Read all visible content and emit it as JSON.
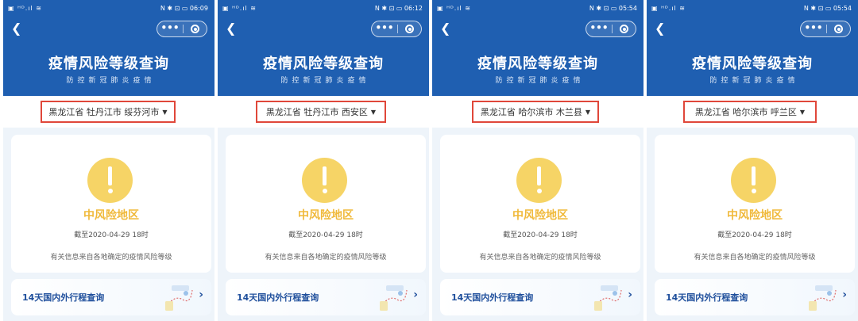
{
  "app": {
    "title": "疫情风险等级查询",
    "subtitle": "防控新冠肺炎疫情",
    "back_icon": "chevron-left-icon",
    "menu_icon": "more-dots-icon",
    "close_icon": "target-circle-icon",
    "header_color": "#1f5fb1",
    "highlight_color": "#e0473a",
    "risk_color": "#f6d466"
  },
  "screens": [
    {
      "status": {
        "left": "▣ ᴴᴰ.ıl ≋",
        "right": "N ✱ ⊡ ▭ 06:09"
      },
      "region": "黑龙江省 牡丹江市 绥芬河市",
      "risk_level": "中风险地区",
      "as_of": "截至2020-04-29 18时",
      "info_note": "有关信息来自各地确定的疫情风险等级",
      "trip_query": "14天国内外行程查询",
      "arrow": "›"
    },
    {
      "status": {
        "left": "▣ ᴴᴰ.ıl ≋",
        "right": "N ✱ ⊡ ▭ 06:12"
      },
      "region": "黑龙江省 牡丹江市 西安区",
      "risk_level": "中风险地区",
      "as_of": "截至2020-04-29 18时",
      "info_note": "有关信息来自各地确定的疫情风险等级",
      "trip_query": "14天国内外行程查询",
      "arrow": "›"
    },
    {
      "status": {
        "left": "▣ ᴴᴰ.ıl ≋",
        "right": "N ✱ ⊡ ▭ 05:54"
      },
      "region": "黑龙江省 哈尔滨市 木兰县",
      "risk_level": "中风险地区",
      "as_of": "截至2020-04-29 18时",
      "info_note": "有关信息来自各地确定的疫情风险等级",
      "trip_query": "14天国内外行程查询",
      "arrow": "›"
    },
    {
      "status": {
        "left": "▣ ᴴᴰ.ıl ≋",
        "right": "N ✱ ⊡ ▭ 05:54"
      },
      "region": "黑龙江省 哈尔滨市 呼兰区",
      "risk_level": "中风险地区",
      "as_of": "截至2020-04-29 18时",
      "info_note": "有关信息来自各地确定的疫情风险等级",
      "trip_query": "14天国内外行程查询",
      "arrow": "›"
    }
  ]
}
